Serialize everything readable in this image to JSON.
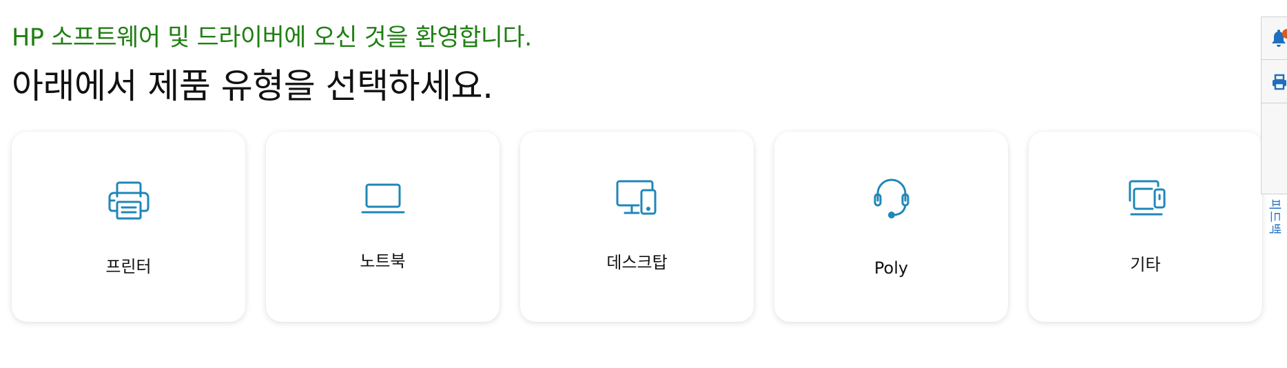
{
  "welcome_text": "HP 소프트웨어 및 드라이버에 오신 것을 환영합니다.",
  "heading": "아래에서 제품 유형을 선택하세요.",
  "colors": {
    "welcome": "#1f7f13",
    "icon": "#1f86b8",
    "side_icon": "#1f6fc0",
    "badge": "#e0581c"
  },
  "product_types": [
    {
      "label": "프린터",
      "icon": "printer-icon"
    },
    {
      "label": "노트북",
      "icon": "laptop-icon"
    },
    {
      "label": "데스크탑",
      "icon": "desktop-icon"
    },
    {
      "label": "Poly",
      "icon": "headset-icon"
    },
    {
      "label": "기타",
      "icon": "devices-icon"
    }
  ],
  "side_panel": {
    "items": [
      {
        "icon": "bell-icon"
      },
      {
        "icon": "print-icon"
      }
    ],
    "feedback_label": "피드백"
  }
}
